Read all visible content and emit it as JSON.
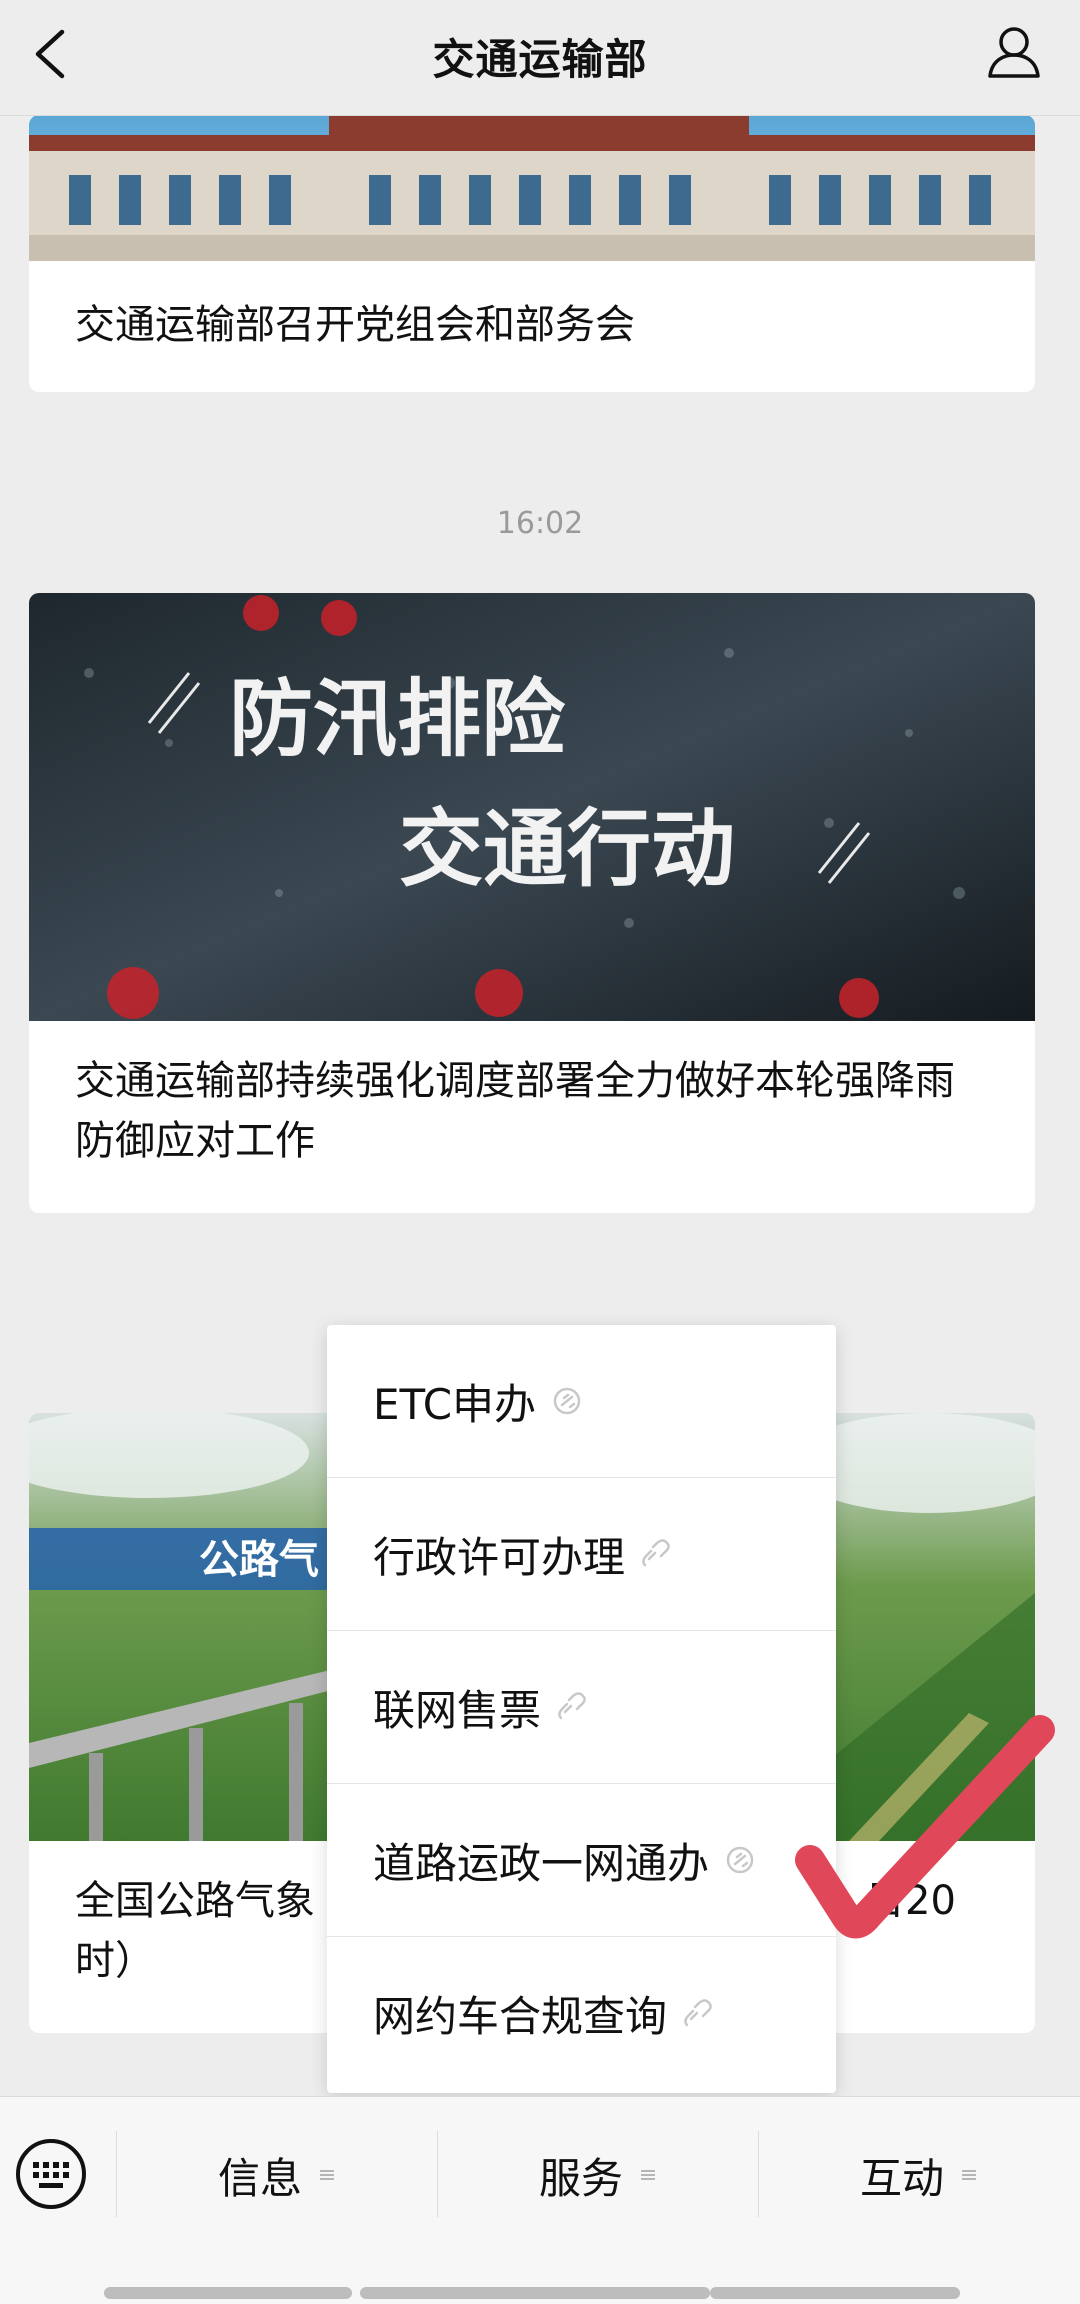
{
  "header": {
    "title": "交通运输部",
    "back_icon": "chevron-left-icon",
    "profile_icon": "user-icon"
  },
  "feed": {
    "card1": {
      "title": "交通运输部召开党组会和部务会",
      "image_desc_icon": "building-photo"
    },
    "timestamp": "16:02",
    "card2": {
      "image_text_line1": "防汛排险",
      "image_text_line2": "交通行动",
      "title": "交通运输部持续强化调度部署全力做好本轮强降雨防御应对工作"
    },
    "card3": {
      "image_banner": "公路气",
      "title_left": "全国公路气象",
      "title_left_line2": "时）",
      "title_right": "日20"
    }
  },
  "popup_menu": {
    "items": [
      {
        "label": "ETC申办"
      },
      {
        "label": "行政许可办理"
      },
      {
        "label": "联网售票"
      },
      {
        "label": "道路运政一网通办"
      },
      {
        "label": "网约车合规查询"
      }
    ]
  },
  "bottom_menu": {
    "tabs": [
      {
        "label": "信息"
      },
      {
        "label": "服务"
      },
      {
        "label": "互动"
      }
    ]
  },
  "colors": {
    "check_mark": "#e0485a",
    "background": "#ededed"
  }
}
